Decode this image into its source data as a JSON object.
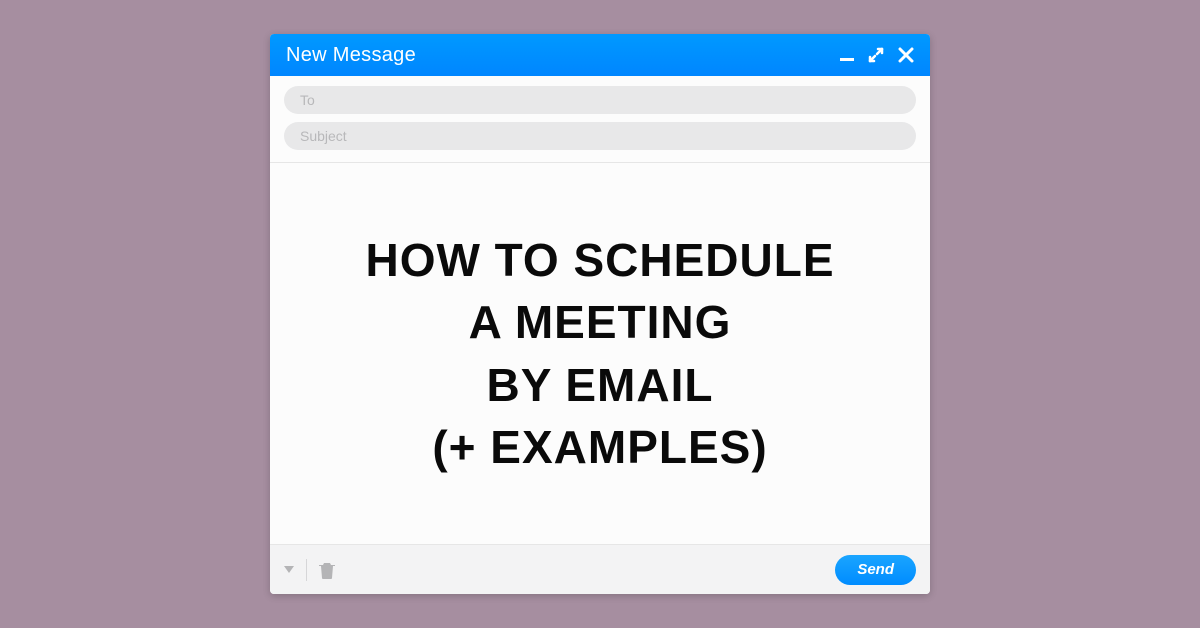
{
  "titlebar": {
    "title": "New Message"
  },
  "fields": {
    "to_placeholder": "To",
    "subject_placeholder": "Subject"
  },
  "headline": {
    "line1": "How to Schedule",
    "line2": "a Meeting",
    "line3": "by Email",
    "line4": "(+ Examples)"
  },
  "toolbar": {
    "send_label": "Send"
  }
}
